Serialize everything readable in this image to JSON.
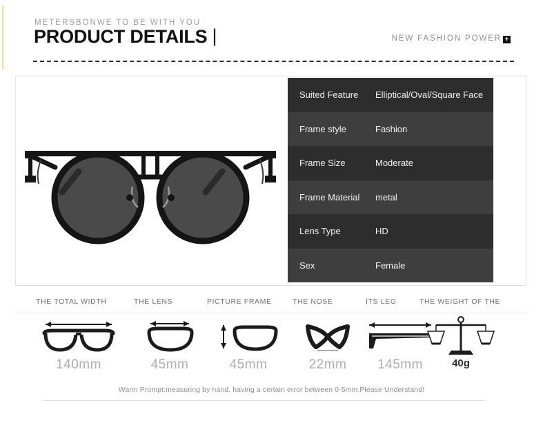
{
  "header": {
    "brand_line": "METERSBONWE TO BE WITH YOU",
    "title": "PRODUCT DETAILS",
    "title_bar": "|",
    "tagline": "NEW FASHION POWER",
    "plus_badge": "+"
  },
  "product": {
    "image_alt": "round-steampunk-sunglasses",
    "frame_color": "#1a1a1a",
    "lens_color": "#4a4a4a"
  },
  "spec_table": {
    "row_color_odd": "#2d2d2d",
    "row_color_even": "#3e3e3e",
    "rows": [
      {
        "key": "Suited Feature",
        "value": "Elliptical/Oval/Square Face"
      },
      {
        "key": "Frame style",
        "value": "Fashion"
      },
      {
        "key": "Frame Size",
        "value": "Moderate"
      },
      {
        "key": "Frame Material",
        "value": "metal"
      },
      {
        "key": "Lens Type",
        "value": "HD"
      },
      {
        "key": "Sex",
        "value": "Female"
      }
    ]
  },
  "measurements": {
    "columns": [
      {
        "header": "THE TOTAL WIDTH",
        "value": "140mm",
        "icon": "glasses-width-icon",
        "bold": false
      },
      {
        "header": "THE LENS",
        "value": "45mm",
        "icon": "lens-width-icon",
        "bold": false
      },
      {
        "header": "PICTURE FRAME",
        "value": "45mm",
        "icon": "lens-height-icon",
        "bold": false
      },
      {
        "header": "THE NOSE",
        "value": "22mm",
        "icon": "nose-bridge-icon",
        "bold": false
      },
      {
        "header": "ITS LEG",
        "value": "145mm",
        "icon": "temple-arm-icon",
        "bold": false
      },
      {
        "header": "THE WEIGHT OF THE",
        "value": "40g",
        "icon": "balance-scale-icon",
        "bold": true
      }
    ]
  },
  "footer": {
    "warm_prompt": "Warm Prompt:measuring by hand, having a certain error between 0-5mm.Please Understand!"
  }
}
